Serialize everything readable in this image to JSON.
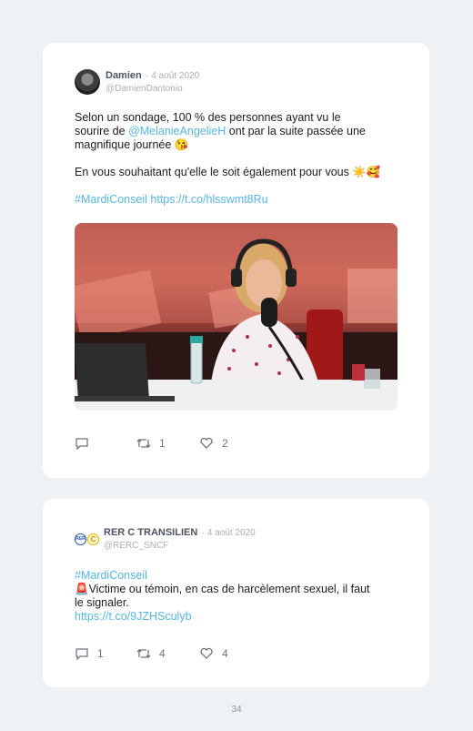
{
  "tweets": [
    {
      "name": "Damien",
      "date": "· 4 août 2020",
      "handle": "@DamienDantonio",
      "line1": "Selon un sondage, 100 % des personnes ayant vu le",
      "line2_pre": "sourire de ",
      "mention": "@MelanieAngelieH",
      "line2_post": " ont par la suite passée une",
      "line3": "magnifique journée 😘",
      "line4": "En vous souhaitant qu'elle le soit également pour vous ☀️🥰",
      "hashtag": "#MardiConseil",
      "url": "https://t.co/hlsswmt8Ru",
      "photo_desc": "",
      "retweets": "1",
      "likes": "2",
      "reply_icon": "reply-icon",
      "retweet_icon": "retweet-icon",
      "like_icon": "heart-icon"
    },
    {
      "name": "RER C TRANSILIEN",
      "date": "· 4 août 2020",
      "handle": "@RERC_SNCF",
      "hashtag": "#MardiConseil",
      "line1": "🚨Victime ou témoin, en cas de harcèlement sexuel, il faut",
      "line2": "le signaler.",
      "url": "https://t.co/9JZHSculyb",
      "replies": "1",
      "retweets": "4",
      "likes": "4",
      "logo_rer": "RER",
      "logo_c": "C"
    }
  ],
  "page_number": "34",
  "colors": {
    "link": "#55b7e9",
    "background": "#eef2f4",
    "card": "#ffffff"
  }
}
